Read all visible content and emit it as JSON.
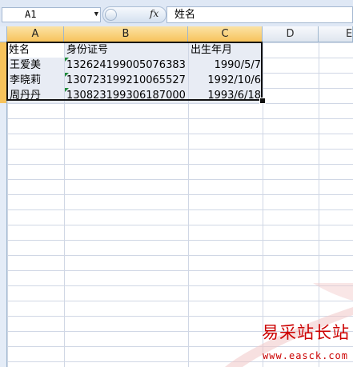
{
  "formula_bar": {
    "name_box": "A1",
    "fx_label": "fx",
    "formula_value": "姓名"
  },
  "columns": [
    "A",
    "B",
    "C",
    "D",
    "E"
  ],
  "rows": [
    {
      "a": "姓名",
      "b": "身份证号",
      "c": "出生年月"
    },
    {
      "a": "王爱美",
      "b": "132624199005076383",
      "c": "1990/5/7"
    },
    {
      "a": "李晓莉",
      "b": "130723199210065527",
      "c": "1992/10/6"
    },
    {
      "a": "周丹丹",
      "b": "130823199306187000",
      "c": "1993/6/18"
    }
  ],
  "watermark": {
    "title": "易采站长站",
    "url": "www.easck.com"
  },
  "colors": {
    "selected_header": "#f7c35c",
    "grid_line": "#d0d7e5",
    "watermark": "#cc0000"
  }
}
